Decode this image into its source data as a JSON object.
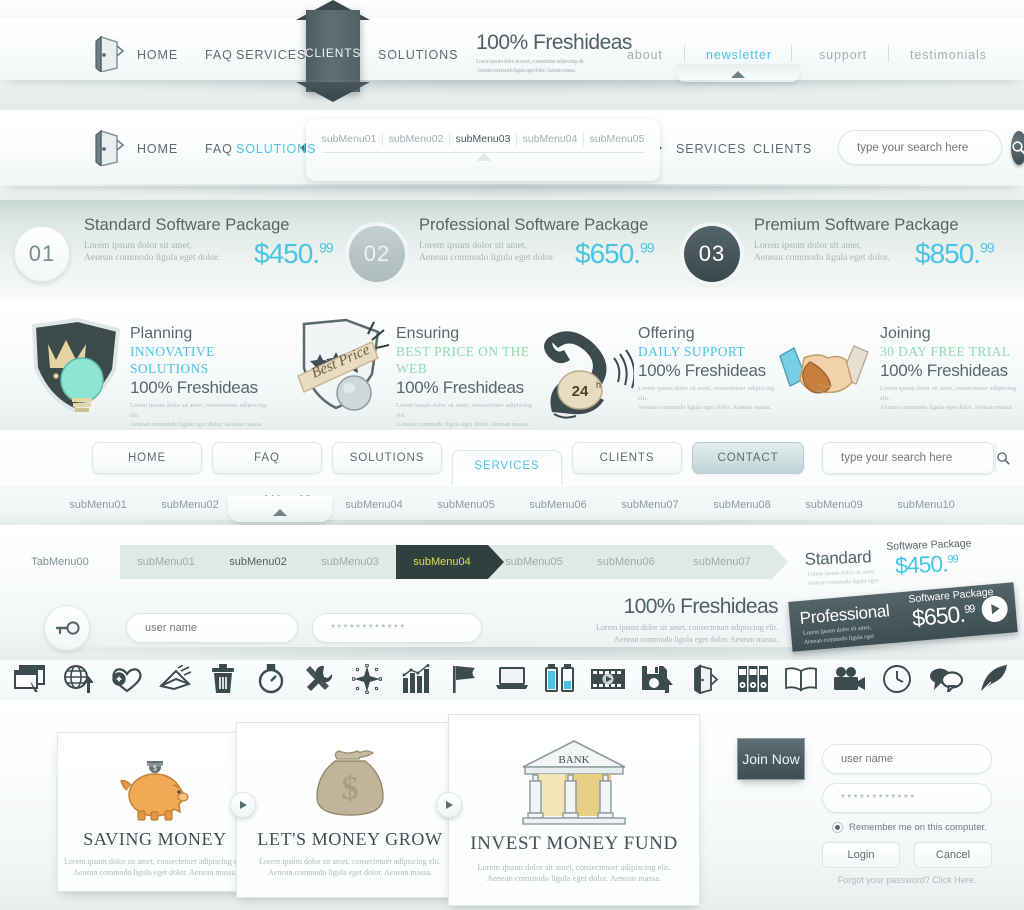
{
  "brand": {
    "name": "100% Freshideas",
    "tagline_line1": "Lorem ipsum dolor sit amet, consectetuer adipiscing elit.",
    "tagline_line2": "Aenean commodo ligula eget dolor. Aenean massa."
  },
  "colors": {
    "accent_cyan": "#49c4e6",
    "accent_green": "#8ddcb2",
    "dark_slate": "#3f5054",
    "active_yellow": "#d8e04a",
    "text_muted": "#9fb0b2"
  },
  "nav_primary": {
    "logo_icon": "door-open-icon",
    "items": [
      "HOME",
      "FAQ",
      "SERVICES",
      "CLIENTS",
      "SOLUTIONS"
    ],
    "active_item": "CLIENTS",
    "right_items": [
      "about",
      "newsletter",
      "support",
      "testimonials"
    ],
    "right_active": "newsletter"
  },
  "nav_secondary": {
    "logo_icon": "door-open-icon",
    "items": [
      "HOME",
      "FAQ",
      "SOLUTIONS",
      "SERVICES",
      "CLIENTS"
    ],
    "active_item": "SOLUTIONS",
    "submenu": [
      "subMenu01",
      "subMenu02",
      "subMenu03",
      "subMenu04",
      "subMenu05"
    ],
    "submenu_active": "subMenu03",
    "search_placeholder": "type your search here",
    "search_value": "",
    "search_icon": "magnifier-icon"
  },
  "packages": {
    "desc_line1": "Lorem ipsum dolor sit amet,",
    "desc_line2": "Aenean commodo ligula eget dolor.",
    "items": [
      {
        "num": "01",
        "title": "Standard Software Package",
        "price": "$450.",
        "cents": "99"
      },
      {
        "num": "02",
        "title": "Professional Software Package",
        "price": "$650.",
        "cents": "99"
      },
      {
        "num": "03",
        "title": "Premium Software Package",
        "price": "$850.",
        "cents": "99"
      }
    ]
  },
  "features": {
    "lorem_line1": "Lorem ipsum dolor sit amet, consectetuer adipiscing elit.",
    "lorem_line2": "Aenean commodo ligula eget dolor. Aenean massa.",
    "fresh": "100% Freshideas",
    "items": [
      {
        "icon": "shield-crown-lightbulb-icon",
        "title": "Planning",
        "subtitle": "INNOVATIVE SOLUTIONS",
        "subtitle_color": "cyan"
      },
      {
        "icon": "best-price-badge-icon",
        "title": "Ensuring",
        "subtitle": "BEST PRICE ON THE WEB",
        "subtitle_color": "green"
      },
      {
        "icon": "telephone-24h-icon",
        "title": "Offering",
        "subtitle": "DAILY SUPPORT",
        "subtitle_color": "cyan"
      },
      {
        "icon": "handshake-icon",
        "title": "Joining",
        "subtitle": "30 DAY FREE TRIAL",
        "subtitle_color": "green"
      }
    ]
  },
  "button_nav": {
    "buttons": [
      "HOME",
      "FAQ",
      "SOLUTIONS",
      "SERVICES",
      "CLIENTS",
      "CONTACT"
    ],
    "active_button": "SERVICES",
    "search_placeholder": "type your search here",
    "search_icon": "magnifier-icon",
    "submenu": [
      "subMenu01",
      "subMenu02",
      "subMenu03",
      "subMenu04",
      "subMenu05",
      "subMenu06",
      "subMenu07",
      "subMenu08",
      "subMenu09",
      "subMenu10"
    ],
    "submenu_active": "subMenu03"
  },
  "breadcrumb": {
    "items": [
      "TabMenu00",
      "subMenu01",
      "subMenu02",
      "subMenu03",
      "subMenu04",
      "subMenu05",
      "subMenu06",
      "subMenu07"
    ],
    "active": "subMenu04",
    "bold": "subMenu02"
  },
  "login_inline": {
    "key_icon": "key-icon",
    "username_placeholder": "user name",
    "password_value": "************"
  },
  "ribbons": [
    {
      "name": "Standard",
      "package": "Software Package",
      "price": "$450.",
      "cents": "99",
      "lorem1": "Lorem ipsum dolor sit amet,",
      "lorem2": "Aenean commodo ligula eget",
      "style": "light"
    },
    {
      "name": "Professional",
      "package": "Software Package",
      "price": "$650.",
      "cents": "99",
      "lorem1": "Lorem ipsum dolor sit amet,",
      "lorem2": "Aenean commodo ligula eget",
      "style": "dark",
      "play_icon": "play-icon"
    }
  ],
  "icon_strip": [
    "browser-window-cursor-icon",
    "globe-upload-icon",
    "heart-plus-icon",
    "paper-plane-mail-icon",
    "trash-can-icon",
    "stopwatch-icon",
    "tools-wrench-screwdriver-icon",
    "compass-star-icon",
    "bar-chart-icon",
    "flag-icon",
    "laptop-icon",
    "battery-icon",
    "film-strip-play-icon",
    "floppy-save-upload-icon",
    "door-open-icon",
    "binders-archive-icon",
    "open-book-icon",
    "movie-camera-icon",
    "clock-icon",
    "speech-bubbles-icon",
    "quill-pen-icon"
  ],
  "cards": {
    "lorem_line1": "Lorem ipsum dolor sit amet, consectetuer adipiscing elit.",
    "lorem_line2": "Aenean commodo ligula eget dolor. Aenean massa.",
    "items": [
      {
        "icon": "piggy-bank-icon",
        "title": "SAVING MONEY"
      },
      {
        "icon": "money-bag-icon",
        "title": "LET'S MONEY GROW"
      },
      {
        "icon": "bank-building-icon",
        "title": "INVEST MONEY FUND",
        "bank_label": "BANK"
      }
    ],
    "next_icon": "play-icon"
  },
  "login_panel": {
    "join_label": "Join Now",
    "username_placeholder": "user name",
    "password_value": "************",
    "remember_label": "Remember me on this computer.",
    "login_label": "Login",
    "cancel_label": "Cancel",
    "forgot_text": "Forgot your password?",
    "forgot_link": "Click Here."
  }
}
